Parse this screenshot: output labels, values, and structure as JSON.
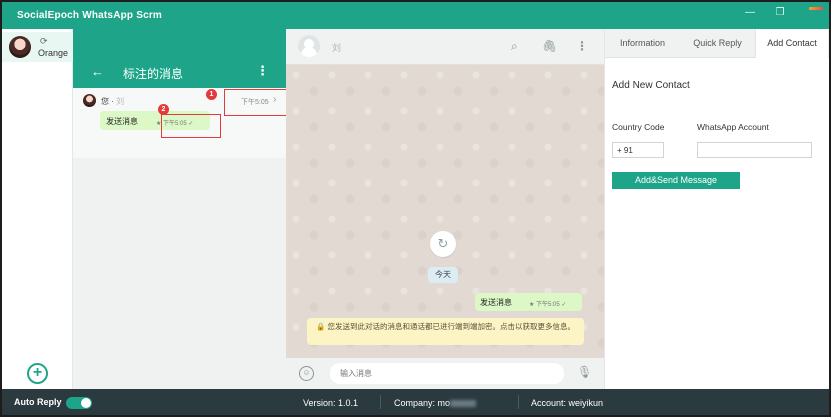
{
  "titlebar": {
    "app_title": "SocialEpoch WhatsApp Scrm",
    "min_icon": "minimize-icon",
    "restore_icon": "restore-icon",
    "close_icon": "close-icon"
  },
  "accounts": {
    "items": [
      {
        "name": "Orange",
        "refresh_icon": "refresh-icon"
      }
    ],
    "add_icon": "plus-circle-icon"
  },
  "starred": {
    "title": "标注的消息",
    "back_icon": "arrow-left-icon",
    "menu_icon": "more-vert-icon",
    "items": [
      {
        "from_prefix": "您 · ",
        "from_name": "刘",
        "time": "下午5:05",
        "text": "发送消息",
        "meta": "★ 下午5:05 ✓"
      }
    ],
    "markers": [
      "1",
      "2"
    ]
  },
  "chat": {
    "contact_name": "刘",
    "date_chip": "今天",
    "messages": [
      {
        "text": "发送消息",
        "meta": "★ 下午5:05 ✓"
      }
    ],
    "encryption_notice": "🔒 您发送到此对话的消息和通话都已进行端到端加密。点击以获取更多信息。",
    "input_placeholder": "输入消息"
  },
  "contact_panel": {
    "tabs": [
      {
        "label": "Information",
        "active": false
      },
      {
        "label": "Quick Reply",
        "active": false
      },
      {
        "label": "Add Contact",
        "active": true
      }
    ],
    "section_title": "Add New Contact",
    "country_code_label": "Country Code",
    "country_code_value": "+ 91",
    "whatsapp_label": "WhatsApp Account",
    "whatsapp_value": "",
    "send_button": "Add&Send Message"
  },
  "statusbar": {
    "auto_reply_label": "Auto Reply",
    "auto_reply_on": true,
    "version": "Version:  1.0.1",
    "company": "Company:  mo",
    "account": "Account:  weiyikun"
  },
  "colors": {
    "brand": "#1ea589",
    "status_bar": "#2b3a3f",
    "outgoing_bubble": "#dcf8c6",
    "notice_bg": "#fdf4c5",
    "annotation_red": "#e23b3b"
  }
}
